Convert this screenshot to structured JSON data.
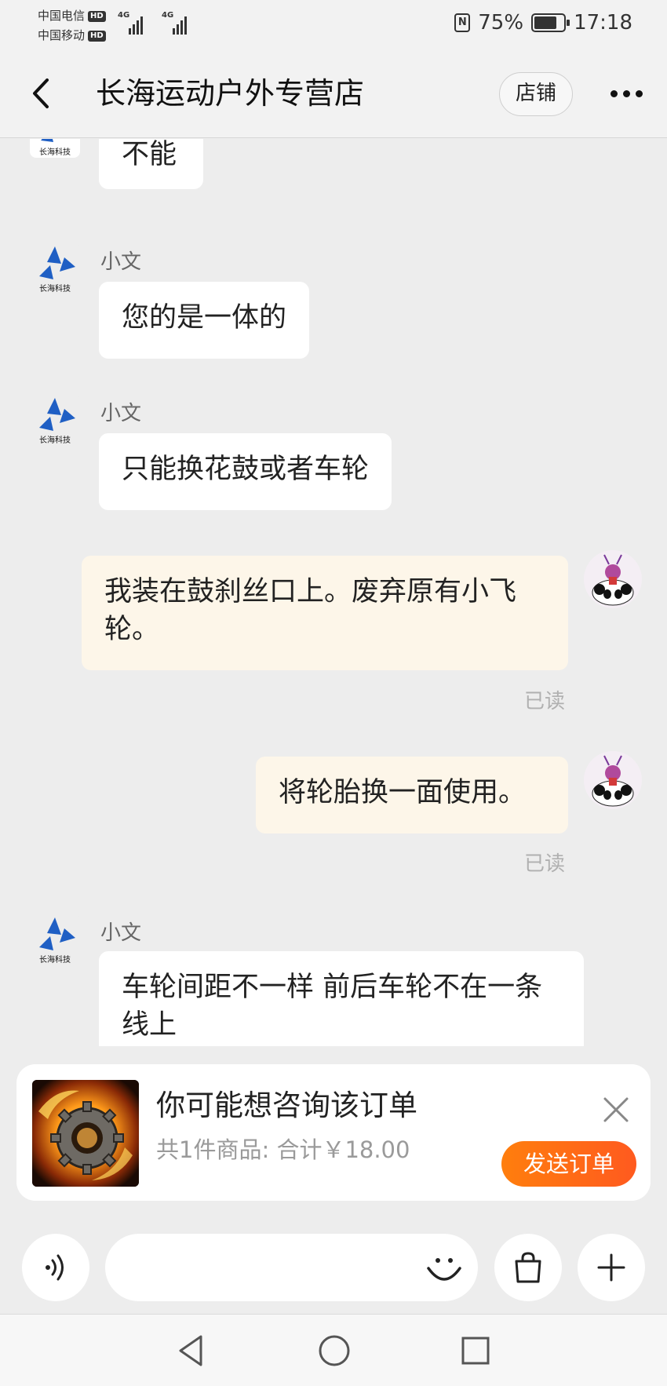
{
  "status_bar": {
    "carrier1": "中国电信",
    "carrier2": "中国移动",
    "hd": "HD",
    "network1": "4G",
    "network2": "4G",
    "nfc": "N",
    "battery": "75%",
    "time": "17:18"
  },
  "header": {
    "title": "长海运动户外专营店",
    "shop_label": "店铺",
    "icons": {
      "back": "chevron-left-icon",
      "more": "more-dots-icon"
    }
  },
  "messages": [
    {
      "side": "in",
      "sender": "",
      "text": "不能"
    },
    {
      "side": "in",
      "sender": "小文",
      "text": "您的是一体的"
    },
    {
      "side": "in",
      "sender": "小文",
      "text": "只能换花鼓或者车轮"
    },
    {
      "side": "out",
      "text": "我装在鼓刹丝口上。废弃原有小飞轮。",
      "status": "已读"
    },
    {
      "side": "out",
      "text": "将轮胎换一面使用。",
      "status": "已读"
    },
    {
      "side": "in",
      "sender": "小文",
      "text": "车轮间距不一样  前后车轮不在一条线上"
    }
  ],
  "order_card": {
    "title": "你可能想咨询该订单",
    "summary": "共1件商品: 合计￥18.00",
    "send_label": "发送订单",
    "thumbnail": "gear-flame-product-image"
  },
  "input_bar": {
    "placeholder": "",
    "icons": [
      "voice-icon",
      "emoji-icon",
      "shopping-bag-icon",
      "plus-icon"
    ]
  },
  "nav_bar": {
    "icons": [
      "back-triangle-icon",
      "home-circle-icon",
      "recents-square-icon"
    ]
  },
  "colors": {
    "background": "#ededed",
    "incoming_bubble": "#ffffff",
    "outgoing_bubble": "#fdf6e9",
    "accent": "#ff6a14",
    "logo_blue": "#1f5fc4"
  }
}
